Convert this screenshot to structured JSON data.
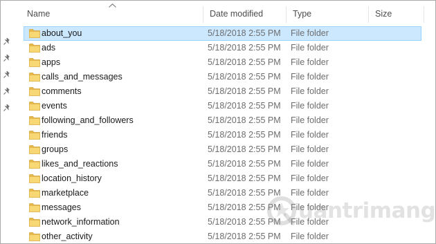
{
  "columns": {
    "name": "Name",
    "date_modified": "Date modified",
    "type": "Type",
    "size": "Size"
  },
  "sort": {
    "column": "Name",
    "direction": "ascending",
    "indicator_icon": "sort-up-arrow"
  },
  "quick_access_pins": 5,
  "rows": [
    {
      "name": "about_you",
      "date": "5/18/2018 2:55 PM",
      "type": "File folder",
      "selected": true
    },
    {
      "name": "ads",
      "date": "5/18/2018 2:55 PM",
      "type": "File folder",
      "selected": false
    },
    {
      "name": "apps",
      "date": "5/18/2018 2:55 PM",
      "type": "File folder",
      "selected": false
    },
    {
      "name": "calls_and_messages",
      "date": "5/18/2018 2:55 PM",
      "type": "File folder",
      "selected": false
    },
    {
      "name": "comments",
      "date": "5/18/2018 2:55 PM",
      "type": "File folder",
      "selected": false
    },
    {
      "name": "events",
      "date": "5/18/2018 2:55 PM",
      "type": "File folder",
      "selected": false
    },
    {
      "name": "following_and_followers",
      "date": "5/18/2018 2:55 PM",
      "type": "File folder",
      "selected": false
    },
    {
      "name": "friends",
      "date": "5/18/2018 2:55 PM",
      "type": "File folder",
      "selected": false
    },
    {
      "name": "groups",
      "date": "5/18/2018 2:55 PM",
      "type": "File folder",
      "selected": false
    },
    {
      "name": "likes_and_reactions",
      "date": "5/18/2018 2:55 PM",
      "type": "File folder",
      "selected": false
    },
    {
      "name": "location_history",
      "date": "5/18/2018 2:55 PM",
      "type": "File folder",
      "selected": false
    },
    {
      "name": "marketplace",
      "date": "5/18/2018 2:55 PM",
      "type": "File folder",
      "selected": false
    },
    {
      "name": "messages",
      "date": "5/18/2018 2:55 PM",
      "type": "File folder",
      "selected": false
    },
    {
      "name": "network_information",
      "date": "5/18/2018 2:55 PM",
      "type": "File folder",
      "selected": false
    },
    {
      "name": "other_activity",
      "date": "5/18/2018 2:55 PM",
      "type": "File folder",
      "selected": false
    }
  ],
  "colors": {
    "selection_bg": "#cce8ff",
    "selection_border": "#99d1ff",
    "folder_yellow": "#f8d775",
    "folder_dark": "#e6b84a"
  },
  "watermark": {
    "text": "uantrimang",
    "logo_icon": "quantrimang-logo-icon"
  }
}
